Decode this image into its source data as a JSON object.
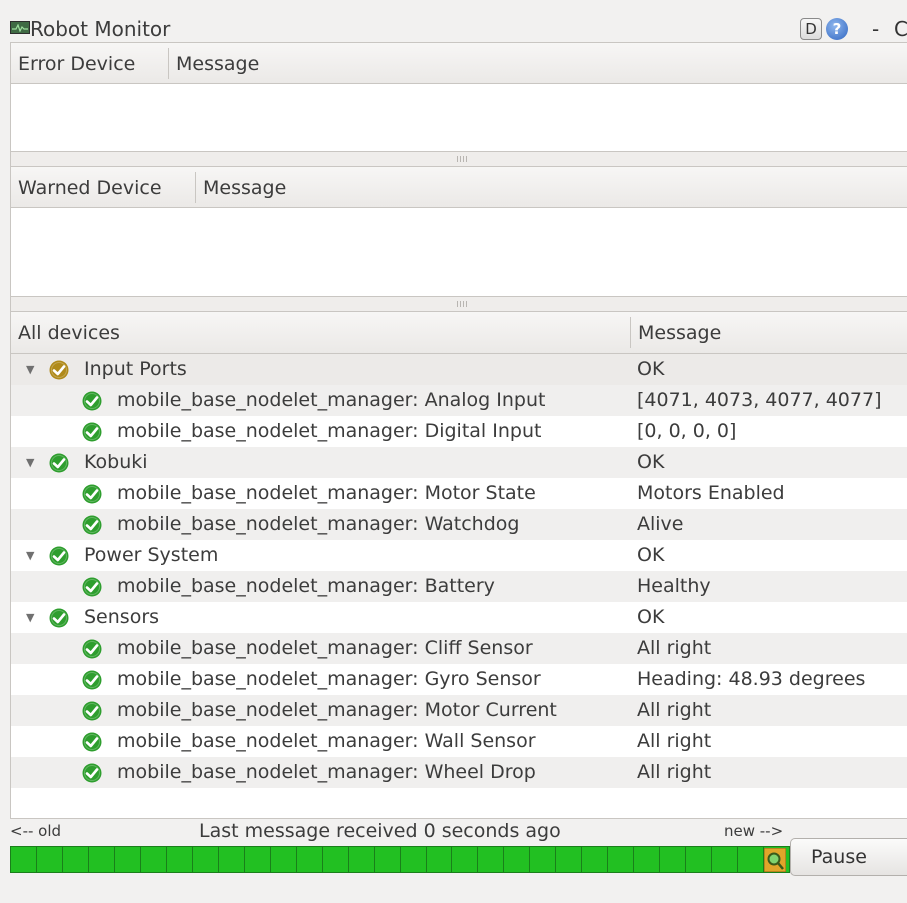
{
  "window": {
    "title": "Robot Monitor",
    "help_d": "D",
    "help_q": "?",
    "minimize": "-",
    "close_partial": "C"
  },
  "error_panel": {
    "col_device": "Error Device",
    "col_message": "Message"
  },
  "warning_panel": {
    "col_device": "Warned Device",
    "col_message": "Message"
  },
  "all_devices": {
    "col_device": "All devices",
    "col_message": "Message",
    "rows": [
      {
        "label": "Input Ports",
        "message": "OK",
        "level": 0,
        "expanded": true,
        "status": "warn-ok"
      },
      {
        "label": "mobile_base_nodelet_manager: Analog Input",
        "message": "[4071, 4073, 4077, 4077]",
        "level": 1,
        "status": "ok"
      },
      {
        "label": "mobile_base_nodelet_manager: Digital Input",
        "message": "[0, 0, 0, 0]",
        "level": 1,
        "status": "ok"
      },
      {
        "label": "Kobuki",
        "message": "OK",
        "level": 0,
        "expanded": true,
        "status": "ok"
      },
      {
        "label": "mobile_base_nodelet_manager: Motor State",
        "message": "Motors Enabled",
        "level": 1,
        "status": "ok"
      },
      {
        "label": "mobile_base_nodelet_manager: Watchdog",
        "message": "Alive",
        "level": 1,
        "status": "ok"
      },
      {
        "label": "Power System",
        "message": "OK",
        "level": 0,
        "expanded": true,
        "status": "ok"
      },
      {
        "label": "mobile_base_nodelet_manager: Battery",
        "message": "Healthy",
        "level": 1,
        "status": "ok"
      },
      {
        "label": "Sensors",
        "message": "OK",
        "level": 0,
        "expanded": true,
        "status": "ok"
      },
      {
        "label": "mobile_base_nodelet_manager: Cliff Sensor",
        "message": "All right",
        "level": 1,
        "status": "ok"
      },
      {
        "label": "mobile_base_nodelet_manager: Gyro Sensor",
        "message": "Heading: 48.93 degrees",
        "level": 1,
        "status": "ok"
      },
      {
        "label": "mobile_base_nodelet_manager: Motor Current",
        "message": "All right",
        "level": 1,
        "status": "ok"
      },
      {
        "label": "mobile_base_nodelet_manager: Wall Sensor",
        "message": "All right",
        "level": 1,
        "status": "ok"
      },
      {
        "label": "mobile_base_nodelet_manager: Wheel Drop",
        "message": "All right",
        "level": 1,
        "status": "ok"
      }
    ]
  },
  "footer": {
    "old_label": "<-- old",
    "status_text": "Last message received 0 seconds ago",
    "new_label": "new -->",
    "pause_label": "Pause"
  },
  "timeline": {
    "segments": 30,
    "color": "#22c022"
  },
  "colors": {
    "ok_icon": "#2e9e2e",
    "warn_icon": "#b08a1a"
  },
  "icons": {
    "app": "robot-monitor-app-icon",
    "ok": "ok-check-icon",
    "expand": "expand-arrow-icon",
    "timeline_marker": "magnifier-icon"
  }
}
